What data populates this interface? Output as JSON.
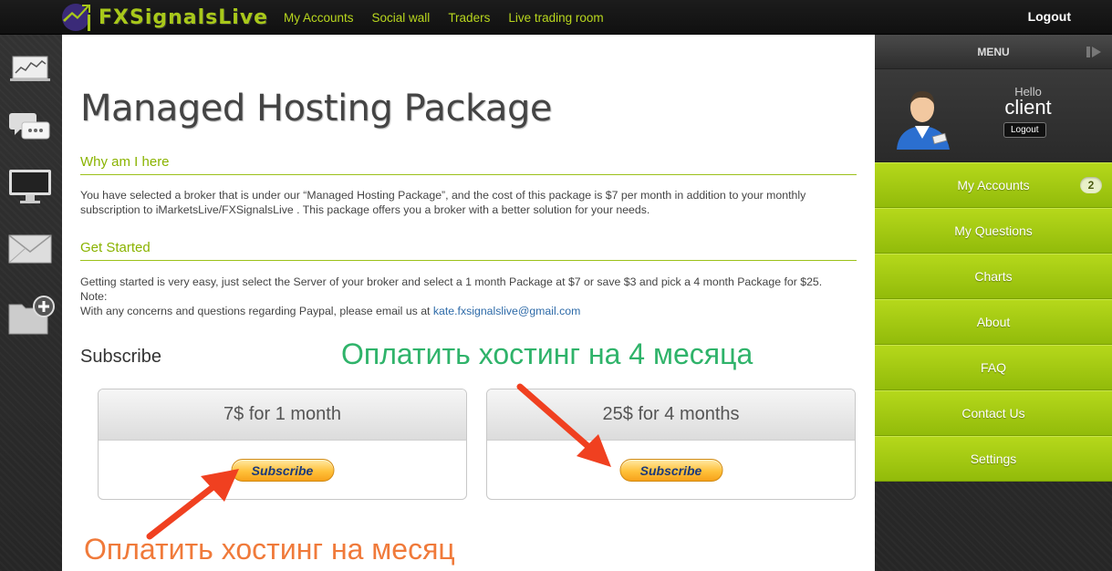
{
  "brand": {
    "logo_text": "FXSignalsLive",
    "accent": "#a8c81a"
  },
  "topnav": {
    "items": [
      "My Accounts",
      "Social wall",
      "Traders",
      "Live trading room"
    ],
    "logout": "Logout"
  },
  "page": {
    "title": "Managed Hosting Package",
    "why_heading": "Why am I here",
    "why_text": "You have selected a broker that is under our “Managed Hosting Package”, and the cost of this package is $7 per month in addition to your monthly subscription to iMarketsLive/FXSignalsLive . This package offers you a broker with a better solution for your needs.",
    "started_heading": "Get Started",
    "started_text": "Getting started is very easy, just select the Server of your broker and select a 1 month Package at $7 or save $3 and pick a 4 month Package for $25.",
    "note_label": "Note:",
    "note_text": "With any concerns and questions regarding Paypal, please email us at ",
    "email": "kate.fxsignalslive@gmail.com",
    "subscribe_heading": "Subscribe",
    "packages": [
      {
        "title": "7$ for 1 month",
        "button": "Subscribe"
      },
      {
        "title": "25$ for 4 months",
        "button": "Subscribe"
      }
    ],
    "annotation_top": "Оплатить хостинг на 4 месяца",
    "annotation_bottom": "Оплатить хостинг на месяц"
  },
  "menu": {
    "title": "MENU",
    "hello": "Hello",
    "username": "client",
    "logout": "Logout",
    "items": [
      {
        "label": "My Accounts",
        "badge": "2"
      },
      {
        "label": "My Questions"
      },
      {
        "label": "Charts"
      },
      {
        "label": "About"
      },
      {
        "label": "FAQ"
      },
      {
        "label": "Contact Us"
      },
      {
        "label": "Settings"
      }
    ]
  }
}
